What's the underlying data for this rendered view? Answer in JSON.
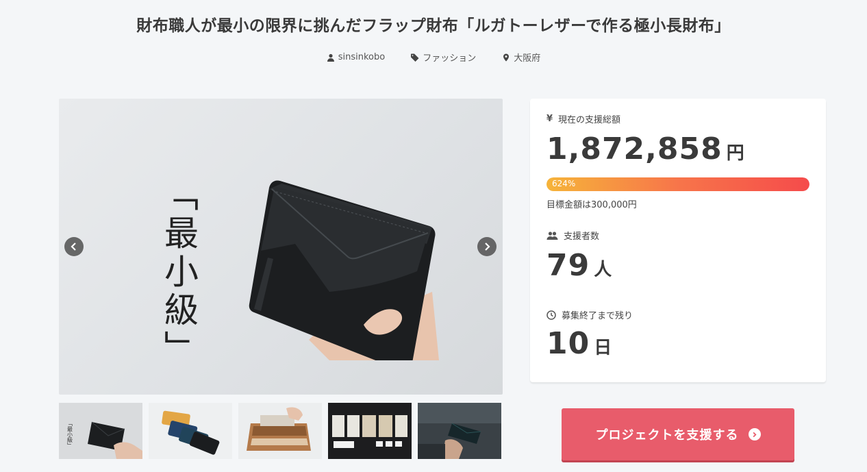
{
  "project": {
    "title": "財布職人が最小の限界に挑んだフラップ財布「ルガトーレザーで作る極小長財布」",
    "author": "sinsinkobo",
    "category": "ファッション",
    "location": "大阪府"
  },
  "hero": {
    "overlay_text": "「最小級」"
  },
  "stats": {
    "total_label": "現在の支援総額",
    "total_amount": "1,872,858",
    "total_unit": "円",
    "progress_percent_text": "624%",
    "progress_fraction": 1.0,
    "goal_text": "目標金額は300,000円",
    "supporters_label": "支援者数",
    "supporters_count": "79",
    "supporters_unit": "人",
    "remaining_label": "募集終了まで残り",
    "remaining_days": "10",
    "remaining_unit": "日"
  },
  "actions": {
    "support_label": "プロジェクトを支援する"
  },
  "icons": {
    "author": "user-icon",
    "category": "tag-icon",
    "location": "map-pin-icon",
    "total": "yen-icon",
    "supporters": "users-icon",
    "remaining": "clock-icon",
    "prev": "chevron-left-icon",
    "next": "chevron-right-icon",
    "support_arrow": "arrow-circle-right-icon"
  },
  "colors": {
    "accent": "#e85c6b",
    "progress_start": "#f6b43a",
    "progress_end": "#f54b4b"
  }
}
